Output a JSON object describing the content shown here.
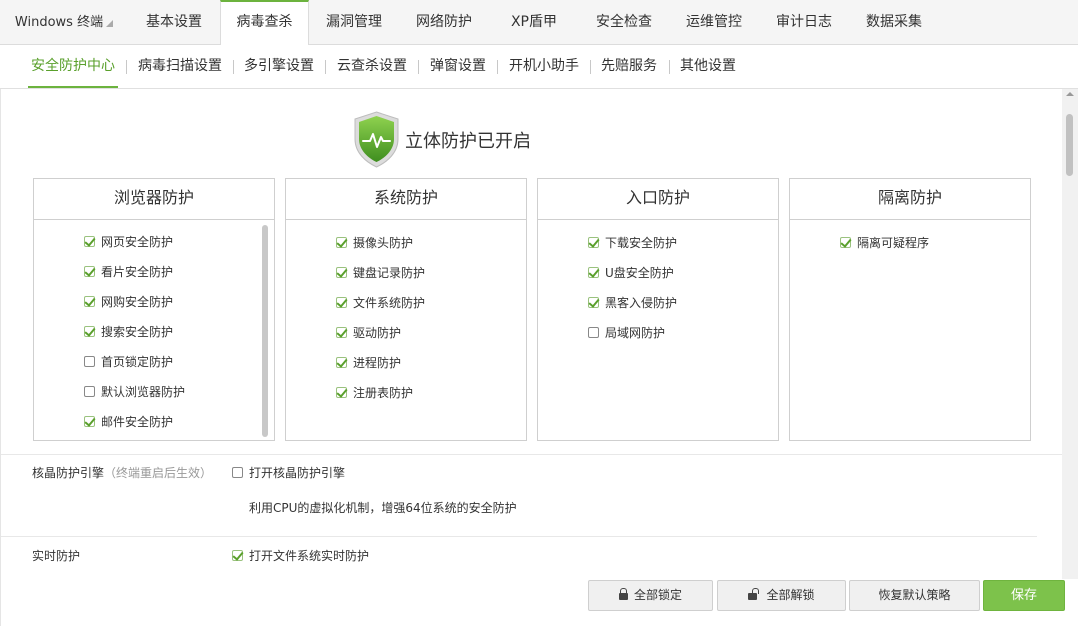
{
  "top_tabs": [
    {
      "label": "Windows 终端"
    },
    {
      "label": "基本设置"
    },
    {
      "label": "病毒查杀",
      "active": true
    },
    {
      "label": "漏洞管理"
    },
    {
      "label": "网络防护"
    },
    {
      "label": "XP盾甲"
    },
    {
      "label": "安全检查"
    },
    {
      "label": "运维管控"
    },
    {
      "label": "审计日志"
    },
    {
      "label": "数据采集"
    }
  ],
  "sub_tabs": [
    {
      "label": "安全防护中心",
      "active": true
    },
    {
      "label": "病毒扫描设置"
    },
    {
      "label": "多引擎设置"
    },
    {
      "label": "云查杀设置"
    },
    {
      "label": "弹窗设置"
    },
    {
      "label": "开机小助手"
    },
    {
      "label": "先赔服务"
    },
    {
      "label": "其他设置"
    }
  ],
  "hero": {
    "title": "立体防护已开启",
    "icon": "shield-check-icon",
    "accent": "#5aa02c"
  },
  "panels": [
    {
      "title": "浏览器防护",
      "items": [
        {
          "label": "网页安全防护",
          "checked": true
        },
        {
          "label": "看片安全防护",
          "checked": true
        },
        {
          "label": "网购安全防护",
          "checked": true
        },
        {
          "label": "搜索安全防护",
          "checked": true
        },
        {
          "label": "首页锁定防护",
          "checked": false
        },
        {
          "label": "默认浏览器防护",
          "checked": false
        },
        {
          "label": "邮件安全防护",
          "checked": true
        }
      ]
    },
    {
      "title": "系统防护",
      "items": [
        {
          "label": "摄像头防护",
          "checked": true
        },
        {
          "label": "键盘记录防护",
          "checked": true
        },
        {
          "label": "文件系统防护",
          "checked": true
        },
        {
          "label": "驱动防护",
          "checked": true
        },
        {
          "label": "进程防护",
          "checked": true
        },
        {
          "label": "注册表防护",
          "checked": true
        }
      ]
    },
    {
      "title": "入口防护",
      "items": [
        {
          "label": "下载安全防护",
          "checked": true
        },
        {
          "label": "U盘安全防护",
          "checked": true
        },
        {
          "label": "黑客入侵防护",
          "checked": true
        },
        {
          "label": "局域网防护",
          "checked": false
        }
      ]
    },
    {
      "title": "隔离防护",
      "items": [
        {
          "label": "隔离可疑程序",
          "checked": true
        }
      ]
    }
  ],
  "kernel": {
    "label": "核晶防护引擎",
    "note": "（终端重启后生效）",
    "option": "打开核晶防护引擎",
    "option_checked": false,
    "description": "利用CPU的虚拟化机制，增强64位系统的安全防护"
  },
  "realtime": {
    "label": "实时防护",
    "option": "打开文件系统实时防护",
    "option_checked": true
  },
  "buttons": {
    "lock_all": "全部锁定",
    "unlock_all": "全部解锁",
    "restore_default": "恢复默认策略",
    "save": "保存"
  }
}
